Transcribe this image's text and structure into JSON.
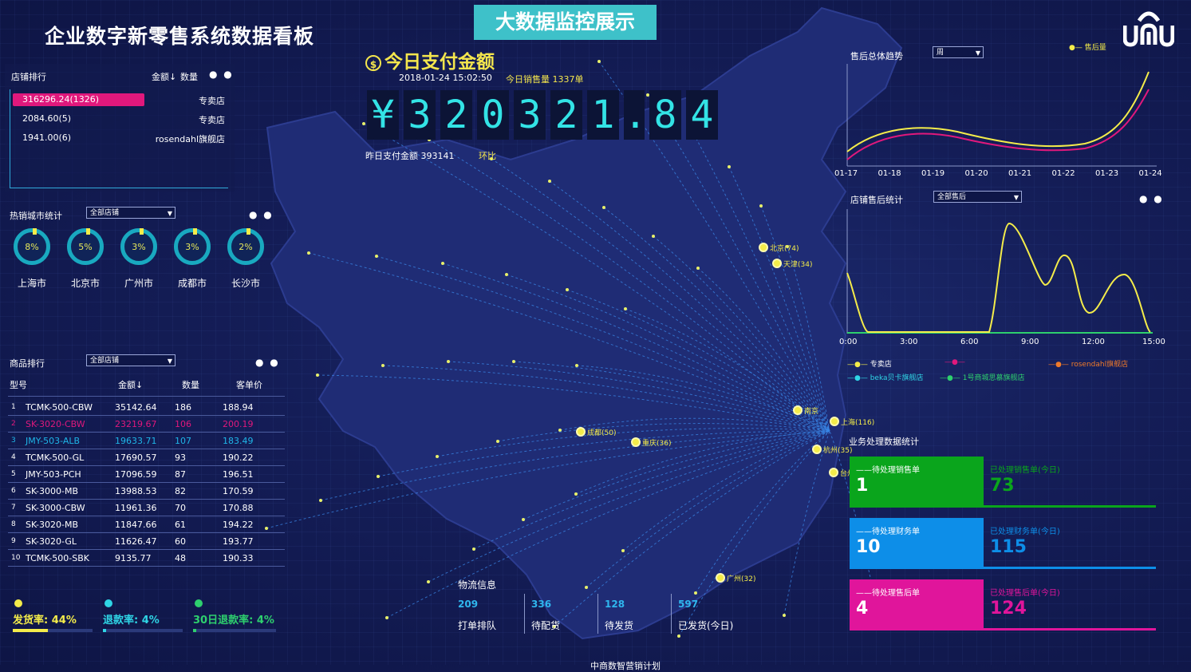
{
  "header": {
    "title": "企业数字新零售系统数据看板",
    "banner": "大数据监控展示",
    "logo_text": "UMU"
  },
  "store_rank": {
    "title": "店铺排行",
    "col_amount": "金额↓",
    "col_qty": "数量",
    "rows": [
      {
        "value": "316296.24(1326)",
        "type": "专卖店"
      },
      {
        "value": "2084.60(5)",
        "type": "专卖店"
      },
      {
        "value": "1941.00(6)",
        "type": "rosendahl旗舰店"
      }
    ]
  },
  "hot_city": {
    "title": "热销城市统计",
    "select": "全部店铺",
    "cities": [
      {
        "name": "上海市",
        "pct": "8%"
      },
      {
        "name": "北京市",
        "pct": "5%"
      },
      {
        "name": "广州市",
        "pct": "3%"
      },
      {
        "name": "成都市",
        "pct": "3%"
      },
      {
        "name": "长沙市",
        "pct": "2%"
      }
    ]
  },
  "product_rank": {
    "title": "商品排行",
    "select": "全部店铺",
    "headers": [
      "型号",
      "金额↓",
      "数量",
      "客单价"
    ],
    "rows": [
      {
        "i": "1",
        "model": "TCMK-500-CBW",
        "amount": "35142.64",
        "qty": "186",
        "price": "188.94",
        "color": "#ffffff"
      },
      {
        "i": "2",
        "model": "SK-3020-CBW",
        "amount": "23219.67",
        "qty": "106",
        "price": "200.19",
        "color": "#e0187c"
      },
      {
        "i": "3",
        "model": "JMY-503-ALB",
        "amount": "19633.71",
        "qty": "107",
        "price": "183.49",
        "color": "#1fb6e8"
      },
      {
        "i": "4",
        "model": "TCMK-500-GL",
        "amount": "17690.57",
        "qty": "93",
        "price": "190.22",
        "color": "#ffffff"
      },
      {
        "i": "5",
        "model": "JMY-503-PCH",
        "amount": "17096.59",
        "qty": "87",
        "price": "196.51",
        "color": "#ffffff"
      },
      {
        "i": "6",
        "model": "SK-3000-MB",
        "amount": "13988.53",
        "qty": "82",
        "price": "170.59",
        "color": "#ffffff"
      },
      {
        "i": "7",
        "model": "SK-3000-CBW",
        "amount": "11961.36",
        "qty": "70",
        "price": "170.88",
        "color": "#ffffff"
      },
      {
        "i": "8",
        "model": "SK-3020-MB",
        "amount": "11847.66",
        "qty": "61",
        "price": "194.22",
        "color": "#ffffff"
      },
      {
        "i": "9",
        "model": "SK-3020-GL",
        "amount": "11626.47",
        "qty": "60",
        "price": "193.77",
        "color": "#ffffff"
      },
      {
        "i": "10",
        "model": "TCMK-500-SBK",
        "amount": "9135.77",
        "qty": "48",
        "price": "190.33",
        "color": "#ffffff"
      }
    ]
  },
  "rates": [
    {
      "label": "发货率: 44%",
      "value": 0.44,
      "color": "#f4ec4a"
    },
    {
      "label": "退款率: 4%",
      "value": 0.04,
      "color": "#2fd6e6"
    },
    {
      "label": "30日退款率: 4%",
      "value": 0.04,
      "color": "#2ed06e"
    }
  ],
  "payment": {
    "title": "今日支付金额",
    "datetime": "2018-01-24 15:02:50",
    "today_sales": "今日销售量 1337单",
    "amount_chars": [
      "¥",
      "3",
      "2",
      "0",
      "3",
      "2",
      "1",
      ".",
      "8",
      "4"
    ],
    "yesterday": "昨日支付金额  393141",
    "ratio_label": "环比"
  },
  "map": {
    "cities": [
      {
        "label": "北京(74)"
      },
      {
        "label": "天津(34)"
      },
      {
        "label": "成都(50)"
      },
      {
        "label": "重庆(36)"
      },
      {
        "label": "南京"
      },
      {
        "label": "上海(116)"
      },
      {
        "label": "杭州(35)"
      },
      {
        "label": "台州"
      },
      {
        "label": "广州(32)"
      }
    ]
  },
  "logistics": {
    "title": "物流信息",
    "items": [
      {
        "num": "209",
        "label": "打单排队"
      },
      {
        "num": "336",
        "label": "待配货"
      },
      {
        "num": "128",
        "label": "待发货"
      },
      {
        "num": "597",
        "label": "已发货(今日)"
      }
    ]
  },
  "after_sales_trend": {
    "title": "售后总体趋势",
    "select": "周",
    "legend": [
      "售后量"
    ],
    "x_labels": [
      "01-17",
      "01-18",
      "01-19",
      "01-20",
      "01-21",
      "01-22",
      "01-23",
      "01-24"
    ]
  },
  "store_after_sales": {
    "title": "店铺售后统计",
    "select": "全部售后",
    "x_labels": [
      "0:00",
      "3:00",
      "6:00",
      "9:00",
      "12:00",
      "15:00"
    ],
    "legend": [
      {
        "name": "专卖店",
        "color": "#f4ec4a"
      },
      {
        "name": "",
        "color": "#e0187c"
      },
      {
        "name": "rosendahl旗舰店",
        "color": "#f07a2a"
      },
      {
        "name": "beka贝卡旗舰店",
        "color": "#2fd6e6"
      },
      {
        "name": "1号商城思慕旗舰店",
        "color": "#2ed06e"
      }
    ]
  },
  "business": {
    "title": "业务处理数据统计",
    "cards": [
      {
        "label": "——待处理销售单",
        "num": "1",
        "rlabel": "已处理销售单(今日)",
        "rnum": "73",
        "color": "#0aa51c"
      },
      {
        "label": "——待处理财务单",
        "num": "10",
        "rlabel": "已处理财务单(今日)",
        "rnum": "115",
        "color": "#0d8ee8"
      },
      {
        "label": "——待处理售后单",
        "num": "4",
        "rlabel": "已处理售后单(今日)",
        "rnum": "124",
        "color": "#e0159b"
      }
    ]
  },
  "footer": {
    "text": "中商数智营销计划"
  },
  "colors": {
    "bg": "#141d57",
    "accent_cyan": "#33e3e6",
    "accent_yellow": "#f4e64d"
  }
}
